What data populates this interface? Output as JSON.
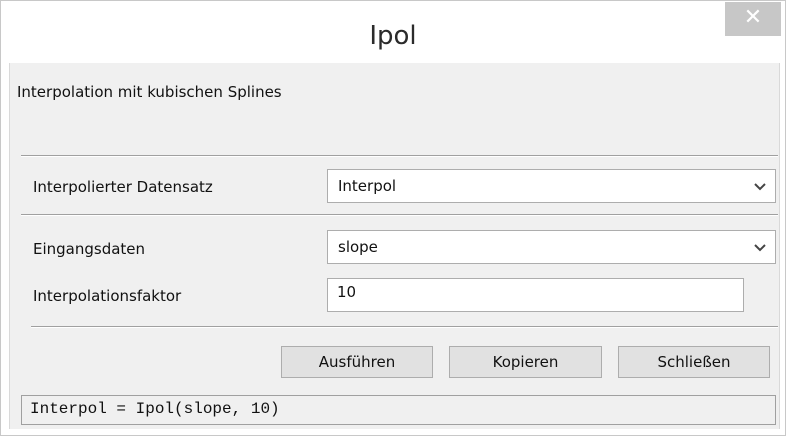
{
  "window": {
    "title": "Ipol",
    "close_symbol": "✕"
  },
  "description": "Interpolation mit kubischen Splines",
  "fields": {
    "interpolated_dataset": {
      "label": "Interpolierter Datensatz",
      "value": "Interpol"
    },
    "input_data": {
      "label": "Eingangsdaten",
      "value": "slope"
    },
    "interpolation_factor": {
      "label": "Interpolationsfaktor",
      "value": "10"
    }
  },
  "buttons": {
    "run": "Ausführen",
    "copy": "Kopieren",
    "close": "Schließen"
  },
  "command_line": "Interpol = Ipol(slope, 10)",
  "icons": {
    "close": "close-icon",
    "dropdown": "chevron-down-icon"
  },
  "colors": {
    "close_button_bg": "#c7c7c7",
    "client_bg": "#f0f0f0",
    "button_bg": "#e1e1e1"
  }
}
